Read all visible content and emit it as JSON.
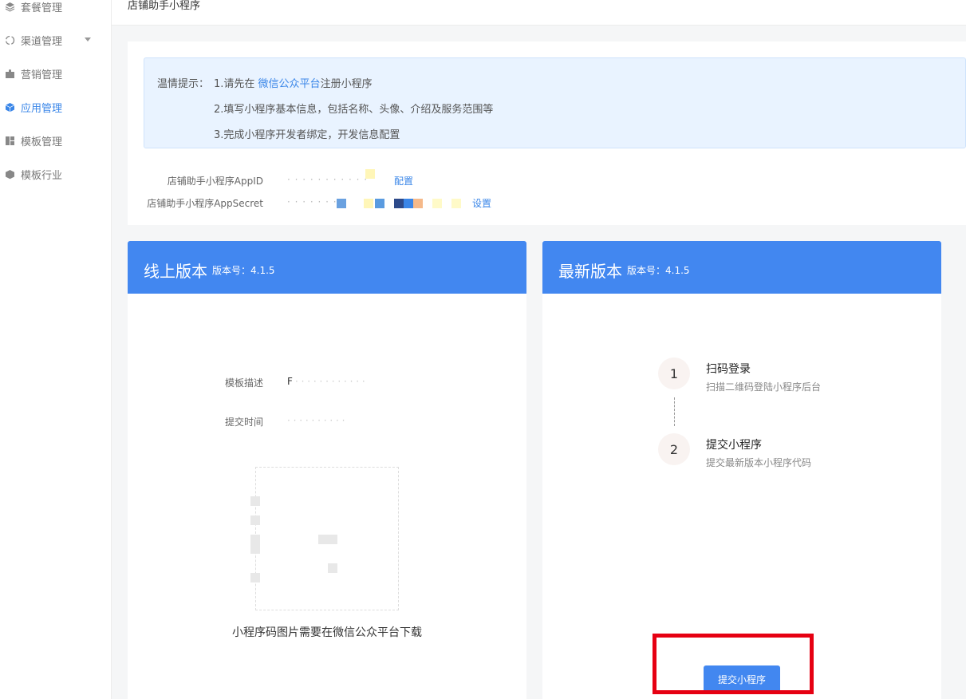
{
  "sidebar": {
    "items": [
      {
        "label": "套餐管理",
        "icon": "layers-icon"
      },
      {
        "label": "渠道管理",
        "icon": "recycle-icon"
      },
      {
        "label": "营销管理",
        "icon": "puzzle-icon"
      },
      {
        "label": "应用管理",
        "icon": "cube-icon",
        "active": true
      },
      {
        "label": "模板管理",
        "icon": "layout-icon"
      },
      {
        "label": "模板行业",
        "icon": "box-icon"
      }
    ]
  },
  "header": {
    "title": "店铺助手小程序"
  },
  "tip": {
    "prefix": "温情提示：",
    "line1_a": "1.请先在 ",
    "line1_link": "微信公众平台",
    "line1_b": "注册小程序",
    "line2": "2.填写小程序基本信息，包括名称、头像、介绍及服务范围等",
    "line3": "3.完成小程序开发者绑定，开发信息配置"
  },
  "config": {
    "appid_label": "店铺助手小程序AppID",
    "appid_link": "配置",
    "secret_label": "店铺助手小程序AppSecret",
    "secret_link": "设置"
  },
  "online": {
    "title": "线上版本",
    "version_label": "版本号：4.1.5",
    "desc_label": "模板描述",
    "desc_value": "F",
    "time_label": "提交时间",
    "qr_caption": "小程序码图片需要在微信公众平台下载"
  },
  "latest": {
    "title": "最新版本",
    "version_label": "版本号：4.1.5",
    "steps": [
      {
        "num": "1",
        "title": "扫码登录",
        "desc": "扫描二维码登陆小程序后台"
      },
      {
        "num": "2",
        "title": "提交小程序",
        "desc": "提交最新版本小程序代码"
      }
    ],
    "submit_label": "提交小程序"
  },
  "colors": {
    "accent": "#4287f0",
    "highlight": "#e60012"
  }
}
